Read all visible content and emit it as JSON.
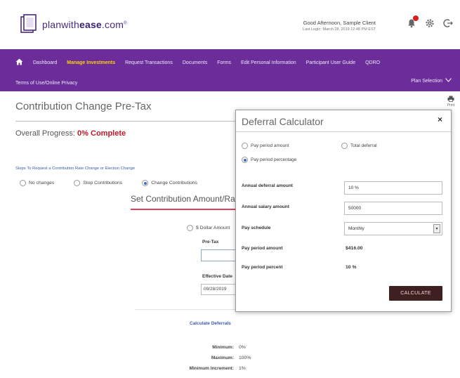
{
  "header": {
    "logo_prefix": "planwith",
    "logo_bold": "ease",
    "logo_suffix": ".com",
    "logo_tm": "®",
    "greeting": "Good Afternoon, Sample Client",
    "last_login": "Last Login: March 28, 2019 12:48 PM EST",
    "icons": [
      "bell-icon",
      "gear-icon",
      "logout-icon"
    ]
  },
  "nav": {
    "items": [
      {
        "label": "Dashboard"
      },
      {
        "label": "Manage Investments"
      },
      {
        "label": "Request Transactions"
      },
      {
        "label": "Documents"
      },
      {
        "label": "Forms"
      },
      {
        "label": "Edit Personal Information"
      },
      {
        "label": "Participant User Guide"
      },
      {
        "label": "QDRO"
      }
    ],
    "row2_item": "Terms of Use/Online Privacy",
    "plan_selection": "Plan Selection",
    "active_color": "#ffd200",
    "bar_color": "#6a2d9a"
  },
  "main": {
    "title": "Contribution Change Pre-Tax",
    "print_label": "Print",
    "progress_label": "Overall Progress:",
    "progress_value": "0% Complete",
    "steps_link": "Steps To Request a Contribution Rate Change or Election Change",
    "options": [
      {
        "label": "No changes",
        "selected": false
      },
      {
        "label": "Stop Contributions",
        "selected": false
      },
      {
        "label": "Change Contributions",
        "selected": true
      }
    ],
    "set_title": "Set Contribution Amount/Ra",
    "dollar_option": "$ Dollar Amount",
    "pretax_label": "Pre-Tax",
    "pretax_value": "",
    "effective_label": "Effective Date",
    "effective_value": "09/28/2019",
    "calc_link": "Calculate Deferrals",
    "limits": [
      {
        "label": "Minimum:",
        "value": "0%"
      },
      {
        "label": "Maximum:",
        "value": "100%"
      },
      {
        "label": "Minimum Increment:",
        "value": "1%"
      }
    ]
  },
  "modal": {
    "title": "Deferral Calculator",
    "close": "×",
    "radios": [
      {
        "label": "Pay period amount",
        "selected": false
      },
      {
        "label": "Total deferral",
        "selected": false
      },
      {
        "label": "Pay period percentage",
        "selected": true
      }
    ],
    "annual_deferral_label": "Annual deferral amount",
    "annual_deferral_value": "10 %",
    "annual_salary_label": "Annual salary amount",
    "annual_salary_value": "50000",
    "pay_schedule_label": "Pay schedule",
    "pay_schedule_value": "Monthly",
    "pay_period_amount_label": "Pay period amount",
    "pay_period_amount_value": "$416.00",
    "pay_period_percent_label": "Pay period percent",
    "pay_period_percent_value": "10 %",
    "calculate_label": "CALCULATE"
  }
}
